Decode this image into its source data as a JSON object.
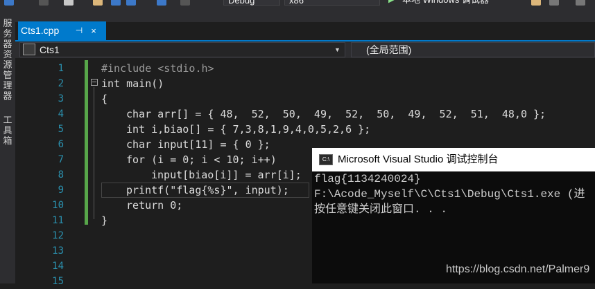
{
  "toolbar": {
    "config_value": "Debug",
    "platform_value": "x86",
    "run_label": "本地 Windows 调试器"
  },
  "side_panels": {
    "server_explorer": "服务器资源管理器",
    "toolbox": "工具箱"
  },
  "tab": {
    "title": "Cts1.cpp",
    "pin_icon": "pin-icon",
    "close_icon": "close-icon",
    "pin_glyph": "⊣",
    "close_glyph": "×"
  },
  "navbar": {
    "project": "Cts1",
    "scope": "(全局范围)",
    "dropdown_glyph": "▼"
  },
  "editor": {
    "line_numbers": [
      "1",
      "2",
      "3",
      "4",
      "5",
      "6",
      "7",
      "8",
      "9",
      "10",
      "11",
      "12",
      "13",
      "14",
      "15"
    ],
    "lines": [
      "#include <stdio.h>",
      "int main()",
      "{",
      "char arr[] = { 48,  52,  50,  49,  52,  50,  49,  52,  51,  48,0 };",
      "int i,biao[] = { 7,3,8,1,9,4,0,5,2,6 };",
      "char input[11] = { 0 };",
      "for (i = 0; i < 10; i++)",
      "input[biao[i]] = arr[i];",
      "printf(\"flag{%s}\", input);",
      "return 0;",
      "}"
    ]
  },
  "console": {
    "title": "Microsoft Visual Studio 调试控制台",
    "icon_label": "C:\\",
    "output": [
      "flag{1134240024}",
      "F:\\Acode_Myself\\C\\Cts1\\Debug\\Cts1.exe (进",
      "按任意键关闭此窗口. . ."
    ]
  },
  "watermark": "https://blog.csdn.net/Palmer9",
  "colors": {
    "accent": "#007acc",
    "keyword": "#569cd6",
    "string": "#d69d85",
    "number": "#b5cea8",
    "line_number": "#2b91af",
    "change_bar": "#57a64a"
  }
}
